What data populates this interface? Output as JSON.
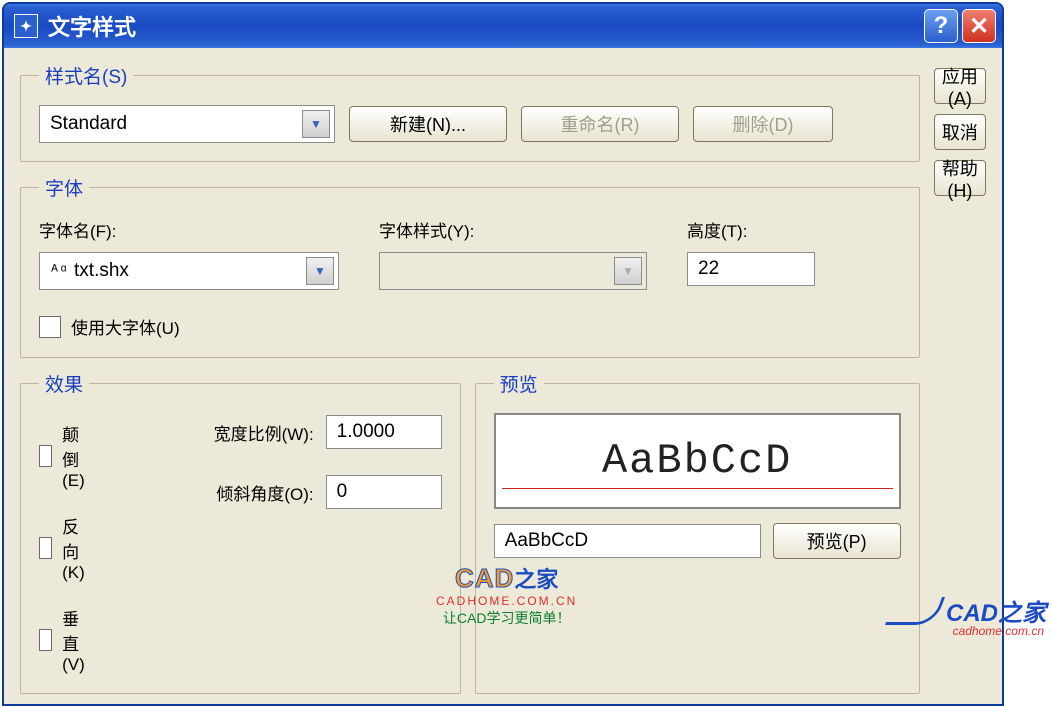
{
  "title": "文字样式",
  "buttons": {
    "apply": "应用(A)",
    "cancel": "取消",
    "help": "帮助(H)",
    "new": "新建(N)...",
    "rename": "重命名(R)",
    "delete": "删除(D)",
    "preview": "预览(P)"
  },
  "groups": {
    "style_name": "样式名(S)",
    "font": "字体",
    "effects": "效果",
    "preview": "预览"
  },
  "labels": {
    "font_name": "字体名(F):",
    "font_style": "字体样式(Y):",
    "height": "高度(T):",
    "use_bigfont": "使用大字体(U)",
    "upside_down": "颠倒(E)",
    "backwards": "反向(K)",
    "vertical": "垂直(V)",
    "width_factor": "宽度比例(W):",
    "oblique_angle": "倾斜角度(O):"
  },
  "values": {
    "style_selected": "Standard",
    "font_selected": "txt.shx",
    "font_style_selected": "",
    "height": "22",
    "width_factor": "1.0000",
    "oblique_angle": "0",
    "preview_large": "AaBbCcD",
    "preview_input": "AaBbCcD"
  },
  "watermark": {
    "cad": "CAD",
    "zhj": "之家",
    "url": "CADHOME.COM.CN",
    "slogan": "让CAD学习更简单！",
    "corner": "CAD之家",
    "corner_url": "cadhome.com.cn"
  }
}
